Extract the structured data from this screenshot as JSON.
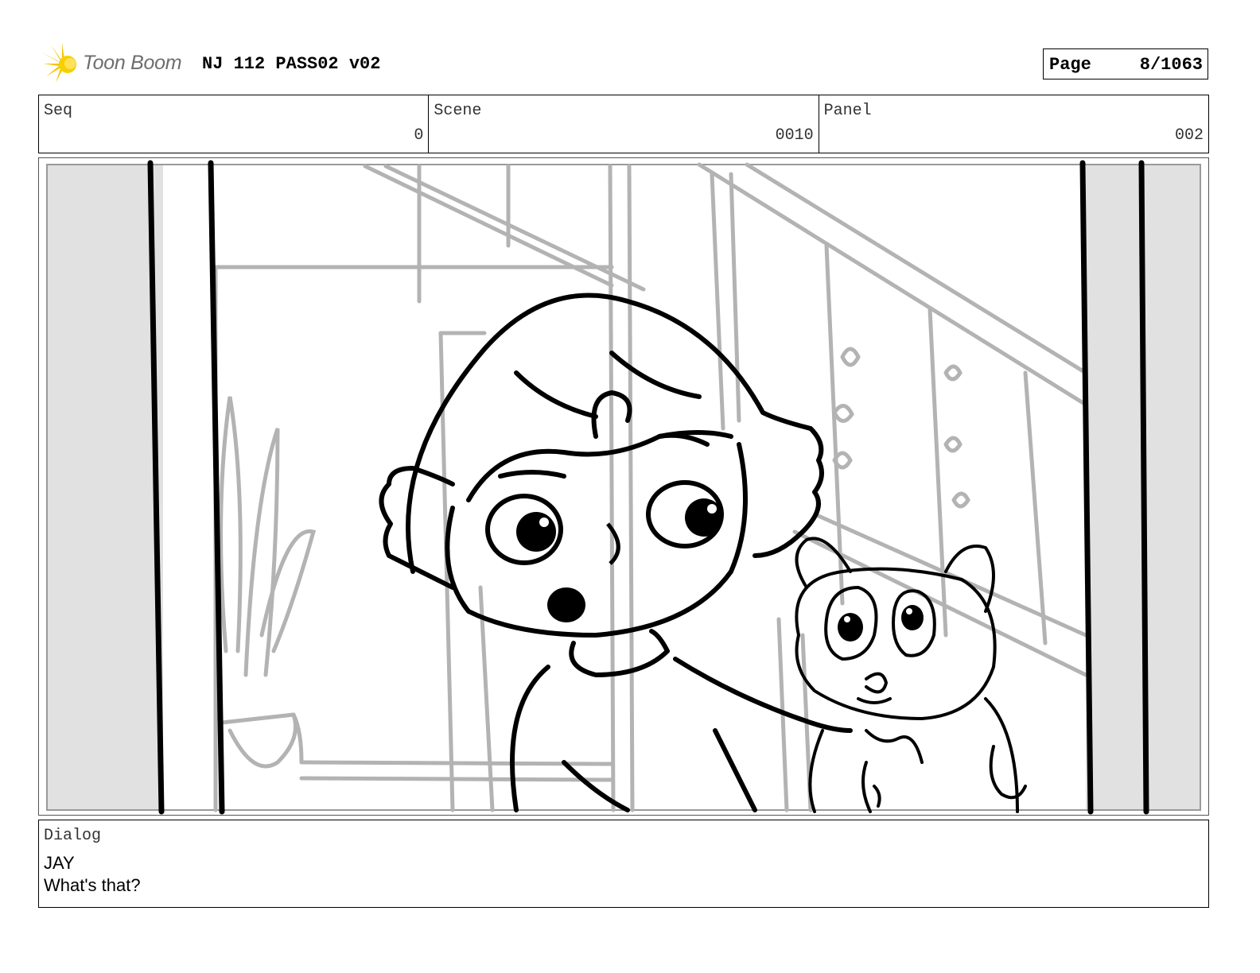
{
  "header": {
    "logo_text": "Toon Boom",
    "title": "NJ 112 PASS02 v02",
    "page_label": "Page",
    "page_value": "8/1063"
  },
  "info": {
    "seq_label": "Seq",
    "seq_value": "0",
    "scene_label": "Scene",
    "scene_value": "0010",
    "panel_label": "Panel",
    "panel_value": "002"
  },
  "dialog": {
    "label": "Dialog",
    "character": "JAY",
    "line": "What's that?"
  },
  "colors": {
    "logo_star": "#f5c400",
    "logo_text": "#6d6d6d",
    "sketch_background": "#b3b3b3",
    "sketch_foreground": "#000000",
    "letterbox": "#e1e1e1"
  }
}
